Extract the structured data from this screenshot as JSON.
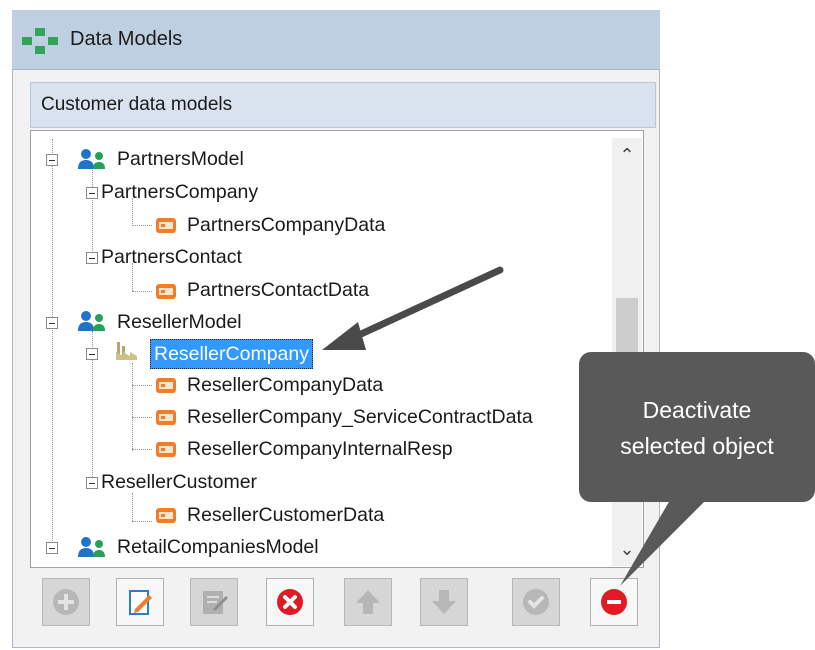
{
  "window": {
    "title": "Data Models",
    "logo_icon": "data-models-icon"
  },
  "section": {
    "title": "Customer data models"
  },
  "tree": {
    "nodes": [
      {
        "label": "PartnersModel",
        "icon": "model-people-icon"
      },
      {
        "label": "PartnersCompany",
        "icon": "none"
      },
      {
        "label": "PartnersCompanyData",
        "icon": "data-card-icon"
      },
      {
        "label": "PartnersContact",
        "icon": "none"
      },
      {
        "label": "PartnersContactData",
        "icon": "data-card-icon"
      },
      {
        "label": "ResellerModel",
        "icon": "model-people-icon"
      },
      {
        "label": "ResellerCompany",
        "icon": "factory-icon",
        "selected": true
      },
      {
        "label": "ResellerCompanyData",
        "icon": "data-card-icon"
      },
      {
        "label": "ResellerCompany_ServiceContractData",
        "icon": "data-card-icon"
      },
      {
        "label": "ResellerCompanyInternalResp",
        "icon": "data-card-icon"
      },
      {
        "label": "ResellerCustomer",
        "icon": "none"
      },
      {
        "label": "ResellerCustomerData",
        "icon": "data-card-icon"
      },
      {
        "label": "RetailCompaniesModel",
        "icon": "model-people-icon"
      }
    ]
  },
  "toolbar": {
    "buttons": [
      {
        "icon": "add-icon",
        "enabled": false
      },
      {
        "icon": "edit-icon",
        "enabled": true
      },
      {
        "icon": "edit-form-icon",
        "enabled": false
      },
      {
        "icon": "delete-icon",
        "enabled": true
      },
      {
        "icon": "move-up-icon",
        "enabled": false
      },
      {
        "icon": "move-down-icon",
        "enabled": false
      },
      {
        "icon": "activate-icon",
        "enabled": false
      },
      {
        "icon": "deactivate-icon",
        "enabled": true
      }
    ]
  },
  "tooltip": {
    "line1": "Deactivate",
    "line2": "selected object"
  },
  "colors": {
    "titlebar": "#bfcfe2",
    "selection": "#3399ff",
    "tooltip": "#595959",
    "model_icon_blue": "#1f73c8",
    "model_icon_green": "#27a05a",
    "data_icon_orange": "#f07d29"
  }
}
